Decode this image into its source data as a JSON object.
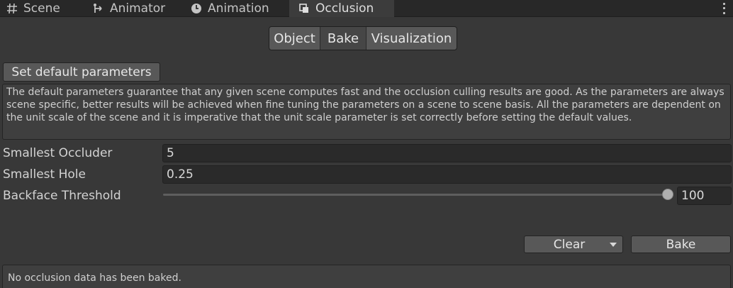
{
  "tabs": [
    {
      "label": "Scene",
      "icon": "grid-icon"
    },
    {
      "label": "Animator",
      "icon": "animator-icon"
    },
    {
      "label": "Animation",
      "icon": "clock-icon"
    },
    {
      "label": "Occlusion",
      "icon": "occlusion-icon",
      "active": true
    }
  ],
  "toolbar": {
    "segments": [
      "Object",
      "Bake",
      "Visualization"
    ],
    "selected": "Bake"
  },
  "set_default_label": "Set default parameters",
  "help_text": "The default parameters guarantee that any given scene computes fast and the occlusion culling results are good. As the parameters are always scene specific, better results will be achieved when fine tuning the parameters on a scene to scene basis. All the parameters are dependent on the unit scale of the scene and it is imperative that the unit scale parameter is set correctly before setting the default values.",
  "fields": {
    "smallest_occluder": {
      "label": "Smallest Occluder",
      "value": "5"
    },
    "smallest_hole": {
      "label": "Smallest Hole",
      "value": "0.25"
    },
    "backface_threshold": {
      "label": "Backface Threshold",
      "value": "100",
      "slider_fraction": 1.0
    }
  },
  "buttons": {
    "clear": "Clear",
    "bake": "Bake"
  },
  "status_text": "No occlusion data has been baked.",
  "colors": {
    "background": "#383838",
    "tabbar": "#282828",
    "button": "#585858",
    "field": "#2a2a2a"
  }
}
